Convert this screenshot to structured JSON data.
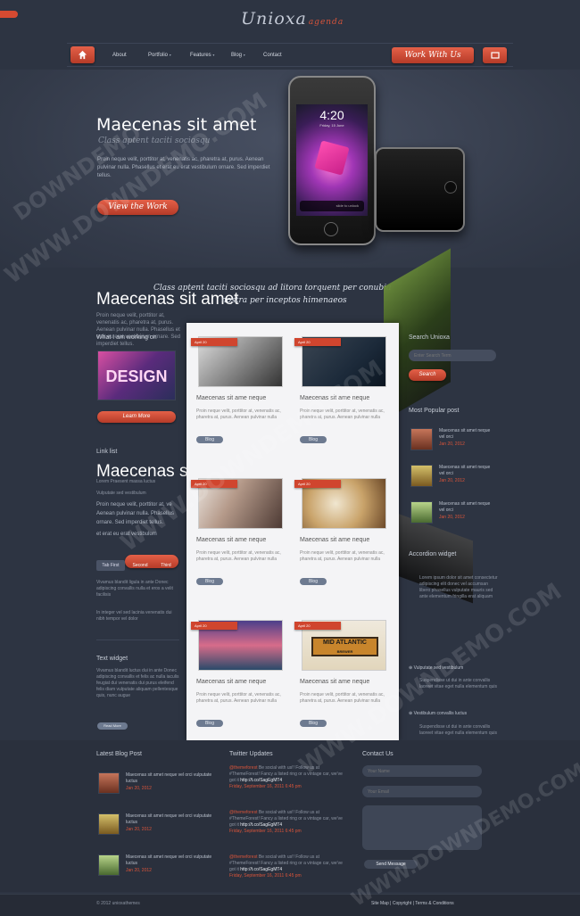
{
  "brand": {
    "name": "Unioxa",
    "sub": "agenda"
  },
  "nav": {
    "items": [
      {
        "label": "About",
        "caret": false
      },
      {
        "label": "Portfolio",
        "caret": true
      },
      {
        "label": "Features",
        "caret": true
      },
      {
        "label": "Blog",
        "caret": true
      },
      {
        "label": "Contact",
        "caret": false
      }
    ],
    "cta": "Work With Us"
  },
  "hero": {
    "title": "Maecenas sit amet",
    "subtitle": "Class aptent taciti sociosqu",
    "body": "Proin neque velit, porttitor at, venenatis ac, pharetra at, purus. Aenean pulvinar nulla. Phasellus et erat eu erat vestibulum ornare. Sed imperdiet tellus.",
    "button": "View the Work",
    "phone_time": "4:20",
    "phone_date": "Friday, 15 June",
    "phone_slider": "slide to unlock"
  },
  "banner": {
    "title": "Maecenas sit amet",
    "script1": "Class aptent taciti sociosqu ad litora torquent per conubia",
    "script2": "nostra per inceptos himenaeos"
  },
  "left": {
    "section_title": "What I am working on",
    "button": "Learn More",
    "list_title": "Link list",
    "big_title": "Maecenas s",
    "list_items": [
      "Lorem Praesent massa luctus",
      "Vulputate sed vestibulum"
    ],
    "body_lines": [
      "Proin neque velit, porttitor at, ve",
      "Aenean pulvinar nulla. Phasellus",
      "ornare. Sed imperdiet tellus.",
      "et erat eu erat vestibulum"
    ],
    "tabs": [
      "Tab First",
      "Second",
      "Third"
    ],
    "tab_text": "Vivamus blandit ligula in ante Donec adipiscing convallis nulla et eros a velit facilisis",
    "tab_text2": "In integer vel sed lacinia venenatis dui nibh tempor vel dolor",
    "text_widget_title": "Text widget",
    "text_widget_body": "Vivamus blandit luctus dui in ante Donec adipiscing convallis et felis ac nulla iaculis feugiat dui venenatis dui purus eleifend felis diam vulputate aliquam pellentesque quis, nunc augue",
    "read_more": "Read More"
  },
  "cards": [
    {
      "title": "Maecenas sit ame neque",
      "text": "Proin neque velit, porttitor at, venenatis ac, pharetra at, purus. Aenean pulvinar nulla",
      "button": "Blog"
    },
    {
      "title": "Maecenas sit ame neque",
      "text": "Proin neque velit, porttitor at, venenatis ac, pharetra at, purus. Aenean pulvinar nulla",
      "button": "Blog"
    },
    {
      "title": "Maecenas sit ame neque",
      "text": "Proin neque velit, porttitor at, venenatis ac, pharetra at, purus. Aenean pulvinar nulla",
      "button": "Blog"
    },
    {
      "title": "Maecenas sit ame neque",
      "text": "Proin neque velit, porttitor at, venenatis ac, pharetra at, purus. Aenean pulvinar nulla",
      "button": "Blog"
    },
    {
      "title": "Maecenas sit ame neque",
      "text": "Proin neque velit, porttitor at, venenatis ac, pharetra at, purus. Aenean pulvinar nulla",
      "button": "Blog"
    },
    {
      "title": "Maecenas sit ame neque",
      "text": "Proin neque velit, porttitor at, venenatis ac, pharetra at, purus. Aenean pulvinar nulla",
      "button": "Blog"
    }
  ],
  "card_ribbon": "April 20",
  "card4_sign": "MID ATLANTIC",
  "card4_sign_sub": "BREWER",
  "right": {
    "search_title": "Search Unioxa",
    "search_placeholder": "Enter Search Term",
    "search_button": "Search",
    "popular_title": "Most Popular post",
    "popular": [
      {
        "title": "Maecenas sit amet neque vel orci",
        "date": "Jan 20, 2012"
      },
      {
        "title": "Maecenas sit amet neque vel orci",
        "date": "Jan 20, 2012"
      },
      {
        "title": "Maecenas sit amet neque vel orci",
        "date": "Jan 20, 2012"
      }
    ],
    "accordion_title": "Accordion widget",
    "accordion_body": "Lorem ipsum dolor sit amet consectetur adipiscing elit donec vel accumsan libero phasellus vulputate mauris sed ante elementum fringilla erat aliquam",
    "accordion_items": [
      "Vulputate sed vestibulum",
      "Vestibulum convallis luctus"
    ],
    "accordion_body2": "Suspendisse ut dui in ante convallis laoreet vitae eget nulla elementum quis"
  },
  "footer": {
    "blog_title": "Latest Blog Post",
    "blog_posts": [
      {
        "title": "Maecenas sit amet neque vel orci vulputate luctus",
        "date": "Jan 20, 2012"
      },
      {
        "title": "Maecenas sit amet neque vel orci vulputate luctus",
        "date": "Jan 20, 2012"
      },
      {
        "title": "Maecenas sit amet neque vel orci vulputate luctus",
        "date": "Jan 20, 2012"
      }
    ],
    "twitter_title": "Twitter Updates",
    "tweets": [
      {
        "user": "@themeforest",
        "text": "Be social with us!! Follow us at #ThemeForest! Fancy a listed ring or a vintage car, we've got it",
        "link": "http://t.co/SagEgMT4",
        "date": "Friday, September 16, 2011 6:45 pm"
      },
      {
        "user": "@themeforest",
        "text": "Be social with us!! Follow us at #ThemeForest! Fancy a listed ring or a vintage car, we've got it",
        "link": "http://t.co/SagEgMT4",
        "date": "Friday, September 16, 2011 6:45 pm"
      },
      {
        "user": "@themeforest",
        "text": "Be social with us!! Follow us at #ThemeForest! Fancy a listed ring or a vintage car, we've got it",
        "link": "http://t.co/SagEgMT4",
        "date": "Friday, September 16, 2011 6:45 pm"
      }
    ],
    "contact_title": "Contact Us",
    "name_placeholder": "Your Name",
    "email_placeholder": "Your Email",
    "submit": "Send Message",
    "copyright": "© 2012 unioxathemes",
    "links": [
      "Site Map",
      "Copyright",
      "Terms & Conditions"
    ]
  },
  "watermarks": [
    "WWW.DOWNDEMO.COM",
    "WWW.DOWNDEMO.COM",
    "WWW.DOWNDEMO.COM",
    "WWW.DOWNDEMO.COM",
    "DOWNDEMO"
  ]
}
